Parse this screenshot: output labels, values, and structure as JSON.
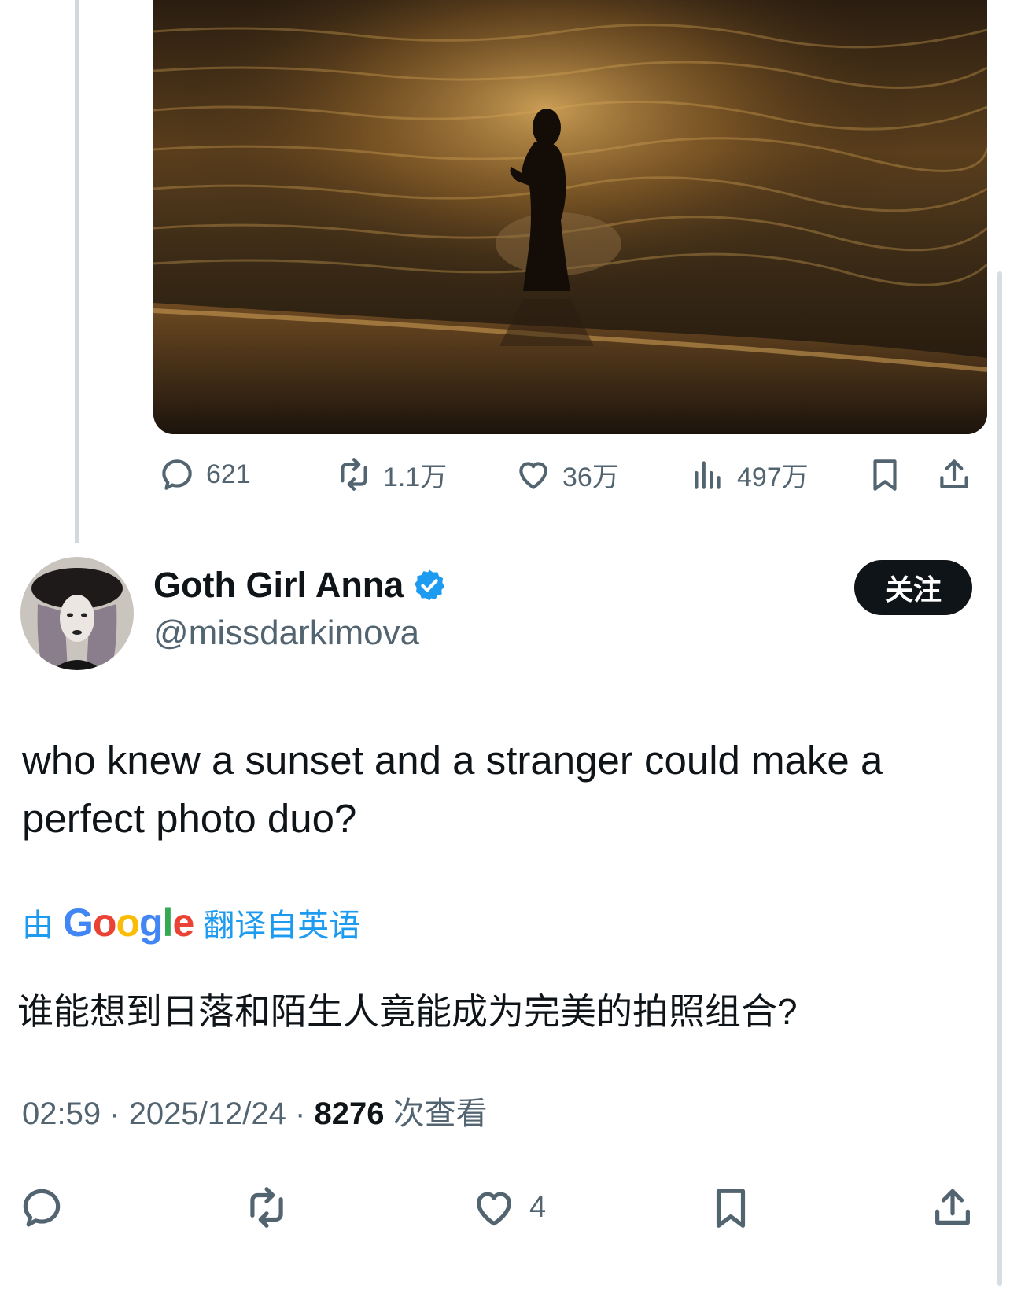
{
  "quoted_tweet": {
    "photo": {
      "icon": "sunset-beach-silhouette-photo"
    },
    "stats": {
      "replies": "621",
      "retweets": "1.1万",
      "likes": "36万",
      "views": "497万"
    }
  },
  "tweet": {
    "author": {
      "display_name": "Goth Girl Anna",
      "handle": "@missdarkimova",
      "verified": true
    },
    "follow_label": "关注",
    "text": "who knew a sunset and a stranger could make a perfect photo duo?",
    "translation": {
      "prefix": "由",
      "provider": "Google",
      "suffix": "翻译自英语",
      "text": "谁能想到日落和陌生人竟能成为完美的拍照组合?"
    },
    "meta": {
      "time": "02:59",
      "sep1": "·",
      "date": "2025/12/24",
      "sep2": "·",
      "views_count": "8276",
      "views_label": "次查看"
    },
    "actions": {
      "like_count": "4"
    }
  },
  "colors": {
    "accent": "#1d9bf0",
    "text_primary": "#0f1419",
    "text_secondary": "#536471",
    "thread_line": "#cfd9de"
  }
}
